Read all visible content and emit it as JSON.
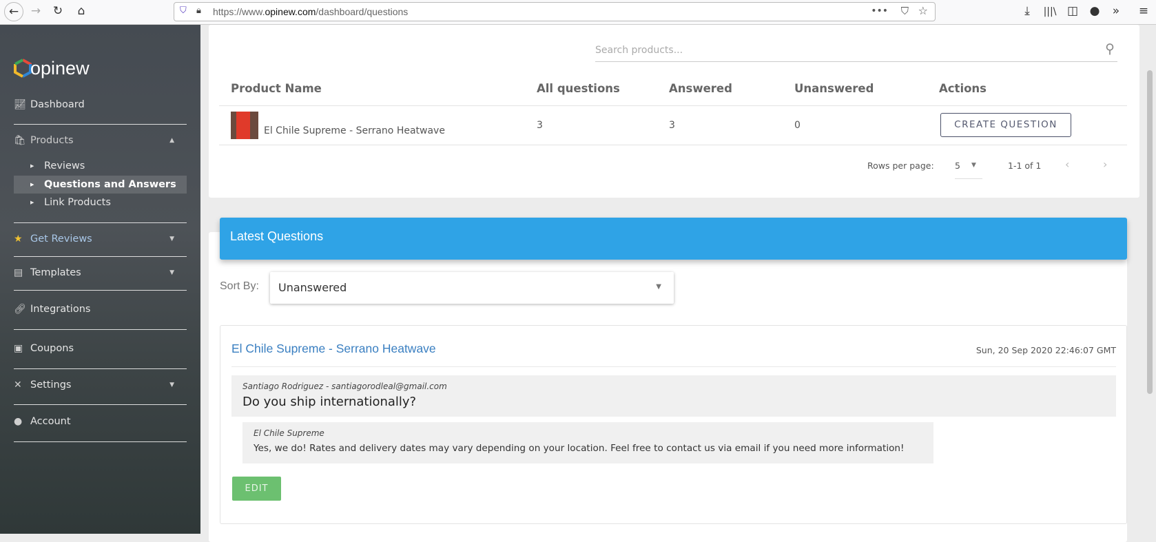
{
  "browser": {
    "url_prefix": "https://www.",
    "url_domain": "opinew.com",
    "url_path": "/dashboard/questions"
  },
  "sidebar": {
    "logo": "opinew",
    "items": [
      {
        "label": "Dashboard",
        "icon": "chart-icon"
      },
      {
        "label": "Products",
        "icon": "bag-icon"
      },
      {
        "label": "Reviews"
      },
      {
        "label": "Questions and Answers"
      },
      {
        "label": "Link Products"
      },
      {
        "label": "Get Reviews",
        "icon": "star-icon"
      },
      {
        "label": "Templates",
        "icon": "templates-icon"
      },
      {
        "label": "Integrations",
        "icon": "link-icon"
      },
      {
        "label": "Coupons",
        "icon": "coupon-icon"
      },
      {
        "label": "Settings",
        "icon": "tools-icon"
      },
      {
        "label": "Account",
        "icon": "user-icon"
      }
    ]
  },
  "products": {
    "search_placeholder": "Search products...",
    "columns": [
      "Product Name",
      "All questions",
      "Answered",
      "Unanswered",
      "Actions"
    ],
    "rows": [
      {
        "name": "El Chile Supreme - Serrano Heatwave",
        "all": "3",
        "answered": "3",
        "unanswered": "0",
        "action": "CREATE QUESTION"
      }
    ],
    "rows_per_page_label": "Rows per page:",
    "rows_per_page": "5",
    "range": "1-1 of 1"
  },
  "latest": {
    "title": "Latest Questions",
    "sort_label": "Sort By:",
    "sort_value": "Unanswered",
    "questions": [
      {
        "product": "El Chile Supreme - Serrano Heatwave",
        "date": "Sun, 20 Sep 2020 22:46:07 GMT",
        "author": "Santiago Rodriguez - santiagorodleal@gmail.com",
        "question": "Do you ship internationally?",
        "answer_author": "El Chile Supreme",
        "answer": "Yes, we do! Rates and delivery dates may vary depending on your location. Feel free to contact us via email if you need more information!",
        "edit_label": "EDIT"
      }
    ]
  },
  "colors": {
    "accent": "#2fa3e6",
    "edit": "#6cc070",
    "link": "#3a7fc1"
  }
}
